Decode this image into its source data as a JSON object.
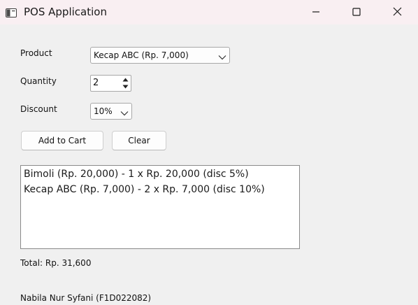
{
  "window": {
    "title": "POS Application",
    "icon": "app-window-icon",
    "controls": [
      "minimize-icon",
      "maximize-icon",
      "close-icon"
    ]
  },
  "form": {
    "product_label": "Product",
    "product_value": "Kecap ABC (Rp. 7,000)",
    "quantity_label": "Quantity",
    "quantity_value": "2",
    "discount_label": "Discount",
    "discount_value": "10%"
  },
  "buttons": {
    "add_to_cart": "Add to Cart",
    "clear": "Clear"
  },
  "cart": {
    "items": [
      "Bimoli (Rp. 20,000) - 1 x Rp. 20,000 (disc 5%)",
      "Kecap ABC (Rp. 7,000) - 2 x Rp. 7,000 (disc 10%)"
    ]
  },
  "total_text": "Total: Rp. 31,600",
  "footer_text": "Nabila Nur Syfani (F1D022082)"
}
